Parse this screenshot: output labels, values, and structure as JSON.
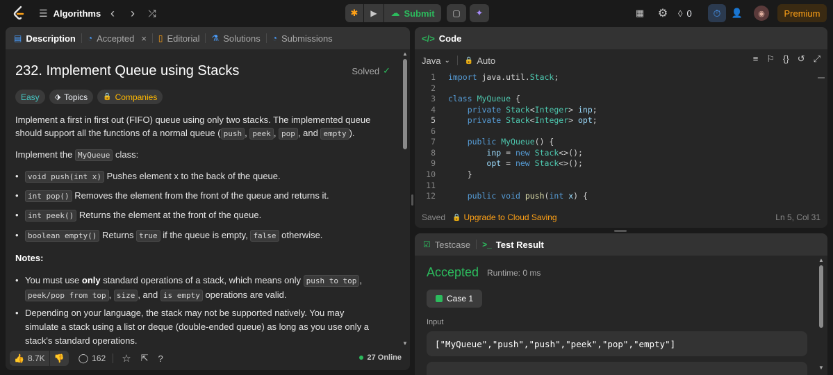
{
  "nav": {
    "problem_list": "Algorithms",
    "submit": "Submit",
    "streak_count": "0",
    "premium": "Premium"
  },
  "description": {
    "tabs": [
      {
        "label": "Description"
      },
      {
        "label": "Accepted"
      },
      {
        "label": "Editorial"
      },
      {
        "label": "Solutions"
      },
      {
        "label": "Submissions"
      }
    ],
    "title": "232. Implement Queue using Stacks",
    "solved_label": "Solved",
    "chips": {
      "difficulty": "Easy",
      "topics": "Topics",
      "companies": "Companies"
    },
    "intro_a": "Implement a first in first out (FIFO) queue using only two stacks. The implemented queue should support all the functions of a normal queue (",
    "intro_codes": [
      "push",
      "peek",
      "pop",
      "empty"
    ],
    "intro_sep1": ", ",
    "intro_sep3": ", and ",
    "intro_b": ").",
    "impl_a": "Implement the ",
    "impl_code": "MyQueue",
    "impl_b": " class:",
    "methods": [
      {
        "code": "void push(int x)",
        "text": " Pushes element x to the back of the queue."
      },
      {
        "code": "int pop()",
        "text": " Removes the element from the front of the queue and returns it."
      },
      {
        "code": "int peek()",
        "text": " Returns the element at the front of the queue."
      },
      {
        "code": "boolean empty()",
        "text": " Returns ",
        "code2": "true",
        "text2": " if the queue is empty, ",
        "code3": "false",
        "text3": " otherwise."
      }
    ],
    "notes_heading": "Notes:",
    "note1": {
      "a": "You must use ",
      "bold": "only",
      "b": " standard operations of a stack, which means only ",
      "c1": "push to top",
      "sep1": ", ",
      "c2": "peek/pop from top",
      "sep2": ", ",
      "c3": "size",
      "sep3": ", and ",
      "c4": "is empty",
      "end": " operations are valid."
    },
    "note2": "Depending on your language, the stack may not be supported natively. You may simulate a stack using a list or deque (double-ended queue) as long as you use only a stack's standard operations.",
    "footer": {
      "likes": "8.7K",
      "comments": "162",
      "online": "27 Online"
    }
  },
  "code": {
    "header": "Code",
    "language": "Java",
    "mode": "Auto",
    "lines": [
      {
        "n": "1",
        "t": "import java.util.Stack;"
      },
      {
        "n": "2",
        "t": ""
      },
      {
        "n": "3",
        "t": "class MyQueue {"
      },
      {
        "n": "4",
        "t": "    private Stack<Integer> inp;"
      },
      {
        "n": "5",
        "t": "    private Stack<Integer> opt;"
      },
      {
        "n": "6",
        "t": ""
      },
      {
        "n": "7",
        "t": "    public MyQueue() {"
      },
      {
        "n": "8",
        "t": "        inp = new Stack<>();"
      },
      {
        "n": "9",
        "t": "        opt = new Stack<>();"
      },
      {
        "n": "10",
        "t": "    }"
      },
      {
        "n": "11",
        "t": ""
      },
      {
        "n": "12",
        "t": "    public void push(int x) {"
      }
    ],
    "saved": "Saved",
    "upgrade": "Upgrade to Cloud Saving",
    "cursor": "Ln 5, Col 31"
  },
  "result": {
    "tabs": [
      {
        "label": "Testcase"
      },
      {
        "label": "Test Result"
      }
    ],
    "status": "Accepted",
    "runtime": "Runtime: 0 ms",
    "case_label": "Case 1",
    "input_label": "Input",
    "input_value": "[\"MyQueue\",\"push\",\"push\",\"peek\",\"pop\",\"empty\"]"
  },
  "colors": {
    "accepted": "#2cbb5d",
    "easy": "#46c6c2",
    "premium": "#ffa116",
    "submit": "#2cbb5d"
  }
}
